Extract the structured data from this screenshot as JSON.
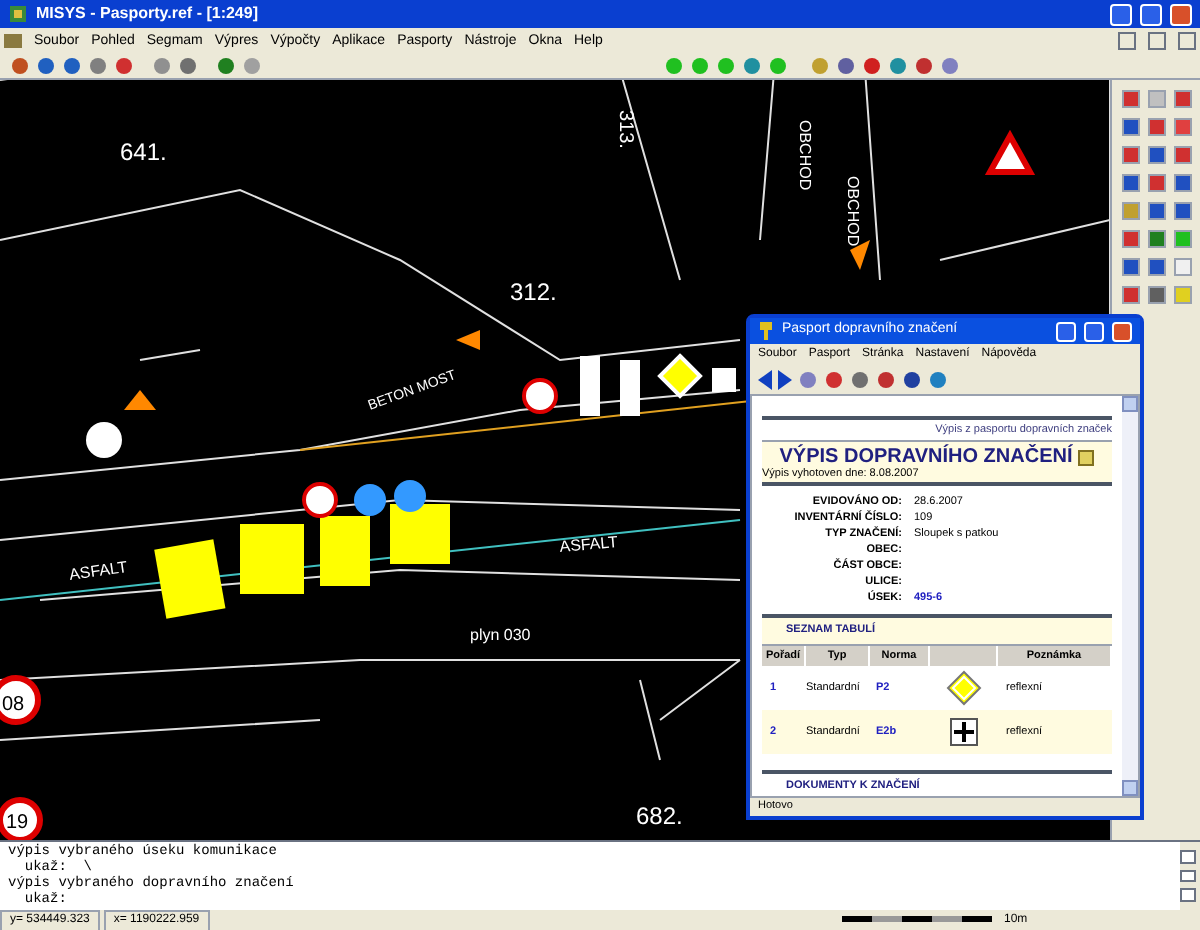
{
  "window": {
    "title": "MISYS - Pasporty.ref - [1:249]"
  },
  "menu": [
    "Soubor",
    "Pohled",
    "Segmam",
    "Výpres",
    "Výpočty",
    "Aplikace",
    "Pasporty",
    "Nástroje",
    "Okna",
    "Help"
  ],
  "map": {
    "labels": [
      "641.",
      "312.",
      "313.",
      "OBCHOD",
      "OBCHOD",
      "ASFALT",
      "ASFALT",
      "BETON MOST",
      "plyn 030",
      "682.",
      "08",
      "19"
    ]
  },
  "popup": {
    "title": "Pasport dopravního značení",
    "menu": [
      "Soubor",
      "Pasport",
      "Stránka",
      "Nastavení",
      "Nápověda"
    ],
    "header": "Výpis z pasportu dopravních značek",
    "heading": "VÝPIS DOPRAVNÍHO ZNAČENÍ",
    "date": "Výpis vyhotoven dne: 8.08.2007",
    "fields": [
      {
        "label": "EVIDOVÁNO OD:",
        "value": "28.6.2007"
      },
      {
        "label": "INVENTÁRNÍ ČÍSLO:",
        "value": "109"
      },
      {
        "label": "TYP ZNAČENÍ:",
        "value": "Sloupek s patkou"
      },
      {
        "label": "OBEC:"
      },
      {
        "label": "ČÁST OBCE:"
      },
      {
        "label": "ULICE:"
      },
      {
        "label": "ÚSEK:",
        "value": "495-6",
        "link": true
      }
    ],
    "section": "SEZNAM TABULÍ",
    "columns": [
      "Pořadí",
      "Typ",
      "Norma",
      "Poznámka"
    ],
    "rows": [
      {
        "order": "1",
        "type": "Standardní",
        "norm": "P2",
        "kind": "diamond",
        "note": "reflexní"
      },
      {
        "order": "2",
        "type": "Standardní",
        "norm": "E2b",
        "kind": "cross",
        "note": "reflexní"
      }
    ],
    "section_2": "DOKUMENTY K ZNAČENÍ",
    "status": "Hotovo"
  },
  "console": [
    "výpis vybraného úseku komunikace",
    "  ukaž:  \\",
    "výpis vybraného dopravního značení",
    "  ukaž: "
  ],
  "status_bar": [
    "y= 534449.323",
    "x= 1190222.959",
    "10m"
  ]
}
